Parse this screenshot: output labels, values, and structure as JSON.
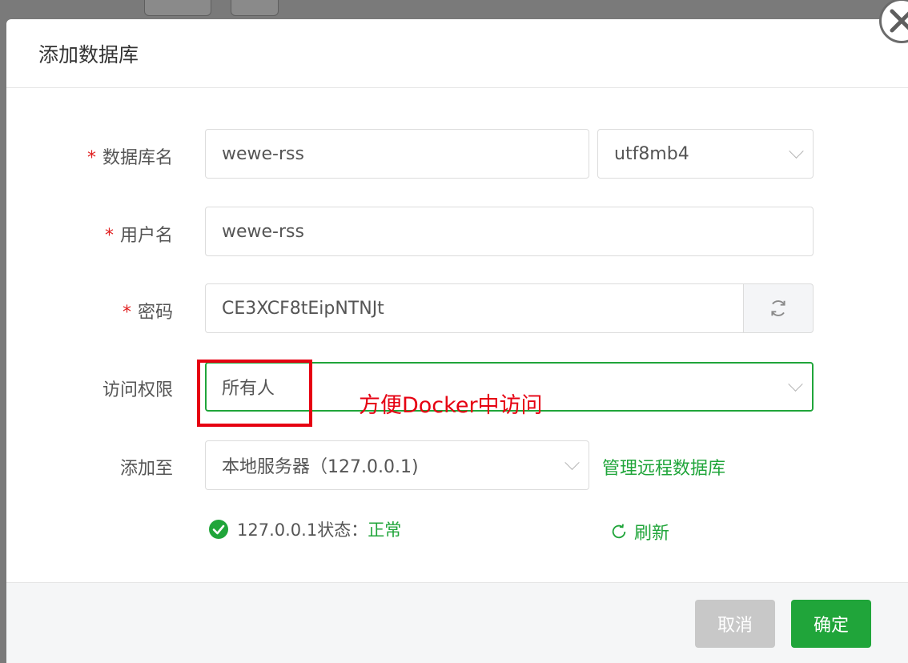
{
  "dialog": {
    "title": "添加数据库",
    "close_icon": "close-icon"
  },
  "form": {
    "db_name": {
      "label": "数据库名",
      "required_mark": "*",
      "value": "wewe-rss"
    },
    "charset": {
      "value": "utf8mb4"
    },
    "username": {
      "label": "用户名",
      "required_mark": "*",
      "value": "wewe-rss"
    },
    "password": {
      "label": "密码",
      "required_mark": "*",
      "value": "CE3XCF8tEipNTNJt",
      "regenerate_icon": "refresh-icon"
    },
    "access": {
      "label": "访问权限",
      "value": "所有人"
    },
    "target": {
      "label": "添加至",
      "value": "本地服务器（127.0.0.1)",
      "manage_link": "管理远程数据库"
    },
    "status": {
      "prefix": "127.0.0.1状态：",
      "state": "正常",
      "refresh_label": "刷新"
    }
  },
  "annotation": {
    "text": "方便Docker中访问",
    "color": "#e60012"
  },
  "footer": {
    "cancel_label": "取消",
    "ok_label": "确定"
  },
  "colors": {
    "accent": "#20a53a",
    "required": "#e02020",
    "overlay": "#7a7a7a"
  }
}
